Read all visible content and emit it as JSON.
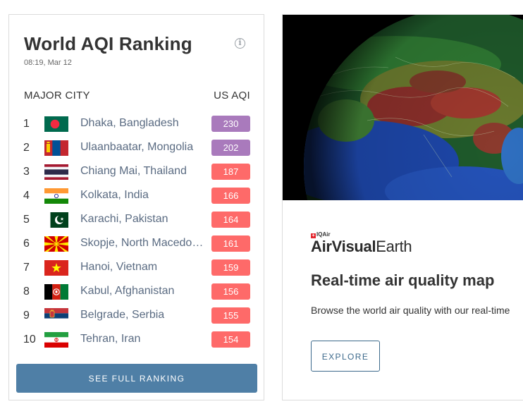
{
  "ranking": {
    "title": "World AQI Ranking",
    "timestamp": "08:19, Mar 12",
    "col_city": "MAJOR CITY",
    "col_aqi": "US AQI",
    "button_label": "SEE FULL RANKING",
    "rows": [
      {
        "rank": "1",
        "city": "Dhaka, Bangladesh",
        "aqi": "230",
        "level": "very-unhealthy",
        "flag": "bangladesh-flag-icon"
      },
      {
        "rank": "2",
        "city": "Ulaanbaatar, Mongolia",
        "aqi": "202",
        "level": "very-unhealthy",
        "flag": "mongolia-flag-icon"
      },
      {
        "rank": "3",
        "city": "Chiang Mai, Thailand",
        "aqi": "187",
        "level": "unhealthy",
        "flag": "thailand-flag-icon"
      },
      {
        "rank": "4",
        "city": "Kolkata, India",
        "aqi": "166",
        "level": "unhealthy",
        "flag": "india-flag-icon"
      },
      {
        "rank": "5",
        "city": "Karachi, Pakistan",
        "aqi": "164",
        "level": "unhealthy",
        "flag": "pakistan-flag-icon"
      },
      {
        "rank": "6",
        "city": "Skopje, North Macedonia",
        "aqi": "161",
        "level": "unhealthy",
        "flag": "north-macedonia-flag-icon"
      },
      {
        "rank": "7",
        "city": "Hanoi, Vietnam",
        "aqi": "159",
        "level": "unhealthy",
        "flag": "vietnam-flag-icon"
      },
      {
        "rank": "8",
        "city": "Kabul, Afghanistan",
        "aqi": "156",
        "level": "unhealthy",
        "flag": "afghanistan-flag-icon"
      },
      {
        "rank": "9",
        "city": "Belgrade, Serbia",
        "aqi": "155",
        "level": "unhealthy",
        "flag": "serbia-flag-icon"
      },
      {
        "rank": "10",
        "city": "Tehran, Iran",
        "aqi": "154",
        "level": "unhealthy",
        "flag": "iran-flag-icon"
      }
    ]
  },
  "earth": {
    "brand_small": "IQAir",
    "brand_strong": "AirVisual",
    "brand_light": "Earth",
    "heading": "Real-time air quality map",
    "description": "Browse the world air quality with our real-time",
    "button_label": "EXPLORE"
  },
  "colors": {
    "very_unhealthy": "#a97abc",
    "unhealthy": "#fe6a69",
    "button": "#4f7fa6"
  }
}
